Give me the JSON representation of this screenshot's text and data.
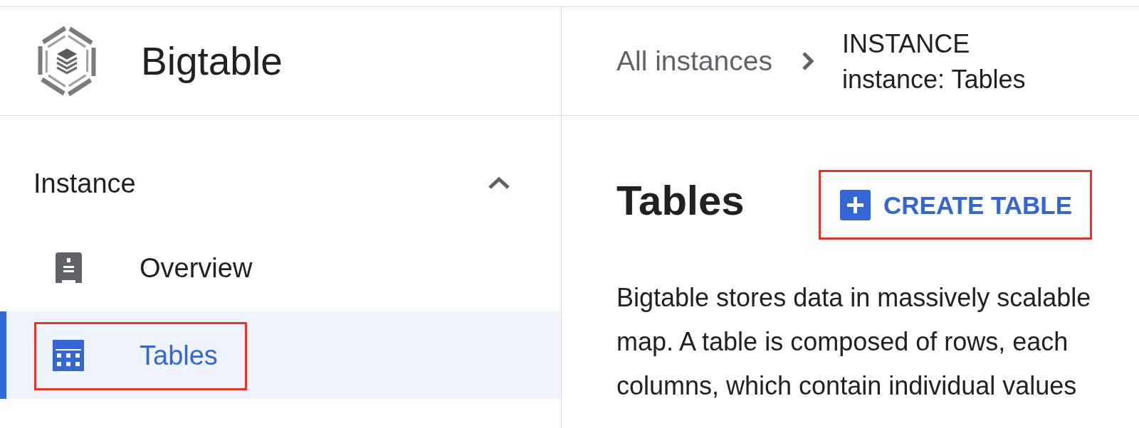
{
  "app": {
    "title": "Bigtable"
  },
  "breadcrumb": {
    "links": [
      {
        "label": "All instances"
      }
    ],
    "current": {
      "kicker": "INSTANCE",
      "title": "instance: Tables"
    }
  },
  "sidebar": {
    "section": {
      "label": "Instance",
      "expanded": true,
      "items": [
        {
          "kind": "overview",
          "label": "Overview",
          "selected": false,
          "annotated": false
        },
        {
          "kind": "table",
          "label": "Tables",
          "selected": true,
          "annotated": true
        }
      ]
    }
  },
  "main": {
    "title": "Tables",
    "action": {
      "label": "CREATE TABLE",
      "annotated": true
    },
    "description": [
      "Bigtable stores data in massively scalable",
      "map. A table is composed of rows, each",
      "columns, which contain individual values"
    ]
  }
}
